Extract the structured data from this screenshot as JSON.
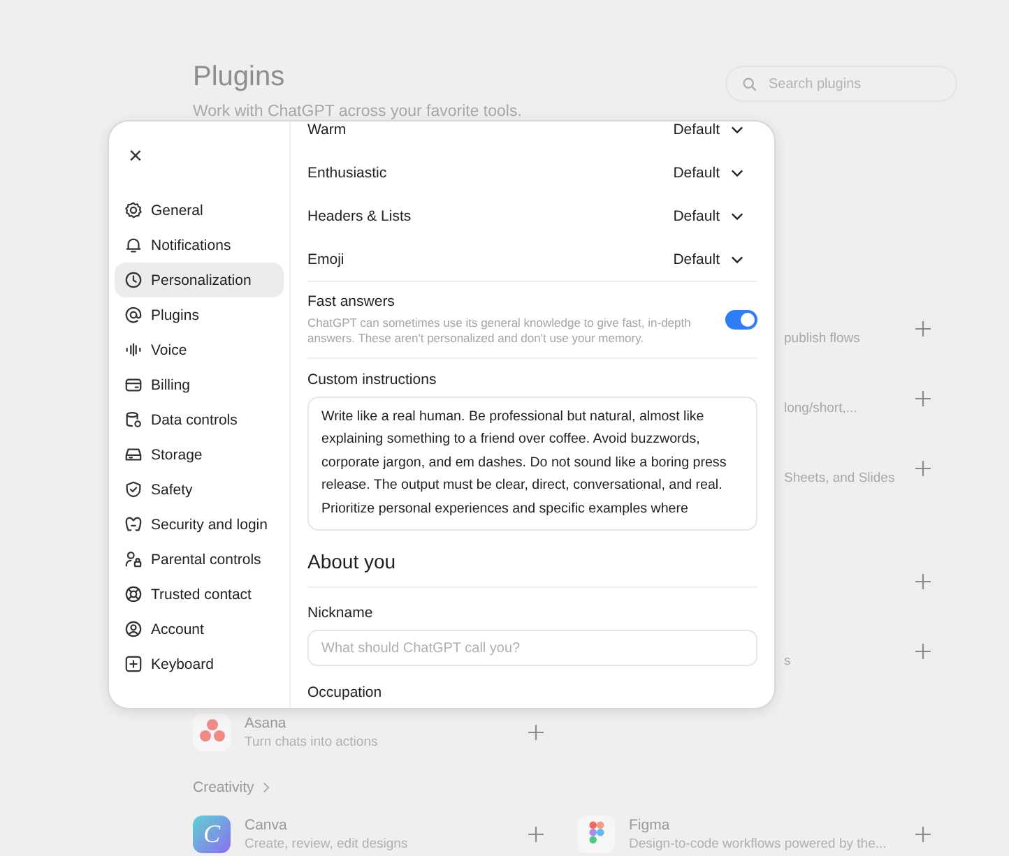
{
  "page": {
    "title": "Plugins",
    "subtitle": "Work with ChatGPT across your favorite tools.",
    "search": {
      "placeholder": "Search plugins"
    }
  },
  "sections": [
    {
      "rows": [
        {
          "right": {
            "kind": "fragment",
            "description": "publish flows"
          }
        },
        {
          "right": {
            "kind": "fragment",
            "description": "long/short,..."
          }
        },
        {
          "right": {
            "kind": "fragment",
            "description": "Sheets, and Slides"
          }
        }
      ]
    },
    {
      "rows": [
        {
          "right": {
            "kind": "add_only"
          }
        },
        {
          "right": {
            "kind": "fragment",
            "description": "s"
          }
        },
        {
          "left": {
            "kind": "plugin",
            "name": "Asana",
            "description": "Turn chats into actions"
          }
        }
      ]
    },
    {
      "title": "Creativity",
      "rows": [
        {
          "left": {
            "kind": "plugin",
            "logo_text": "C",
            "name": "Canva",
            "description": "Create, review, edit designs"
          },
          "right": {
            "kind": "plugin",
            "name": "Figma",
            "description": "Design-to-code workflows powered by the..."
          }
        }
      ]
    }
  ],
  "settings": {
    "close": "×",
    "nav": [
      {
        "label": "General",
        "selected": false
      },
      {
        "label": "Notifications",
        "selected": false
      },
      {
        "label": "Personalization",
        "selected": true
      },
      {
        "label": "Plugins",
        "selected": false
      },
      {
        "label": "Voice",
        "selected": false
      },
      {
        "label": "Billing",
        "selected": false
      },
      {
        "label": "Data controls",
        "selected": false
      },
      {
        "label": "Storage",
        "selected": false
      },
      {
        "label": "Safety",
        "selected": false
      },
      {
        "label": "Security and login",
        "selected": false
      },
      {
        "label": "Parental controls",
        "selected": false
      },
      {
        "label": "Trusted contact",
        "selected": false
      },
      {
        "label": "Account",
        "selected": false
      },
      {
        "label": "Keyboard",
        "selected": false
      }
    ],
    "traits": [
      {
        "label": "Warm",
        "value": "Default"
      },
      {
        "label": "Enthusiastic",
        "value": "Default"
      },
      {
        "label": "Headers & Lists",
        "value": "Default"
      },
      {
        "label": "Emoji",
        "value": "Default"
      }
    ],
    "fast_answers": {
      "label": "Fast answers",
      "description": "ChatGPT can sometimes use its general knowledge to give fast, in-depth answers. These aren't personalized and don't use your memory.",
      "on": true
    },
    "custom_instructions": {
      "label": "Custom instructions",
      "value": "Write like a real human. Be professional but natural, almost like explaining something to a friend over coffee. Avoid buzzwords, corporate jargon, and em dashes. Do not sound like a boring press release. The output must be clear, direct, conversational, and real. Prioritize personal experiences and specific examples where"
    },
    "about_heading": "About you",
    "nickname": {
      "label": "Nickname",
      "placeholder": "What should ChatGPT call you?"
    },
    "occupation": {
      "label": "Occupation"
    }
  }
}
